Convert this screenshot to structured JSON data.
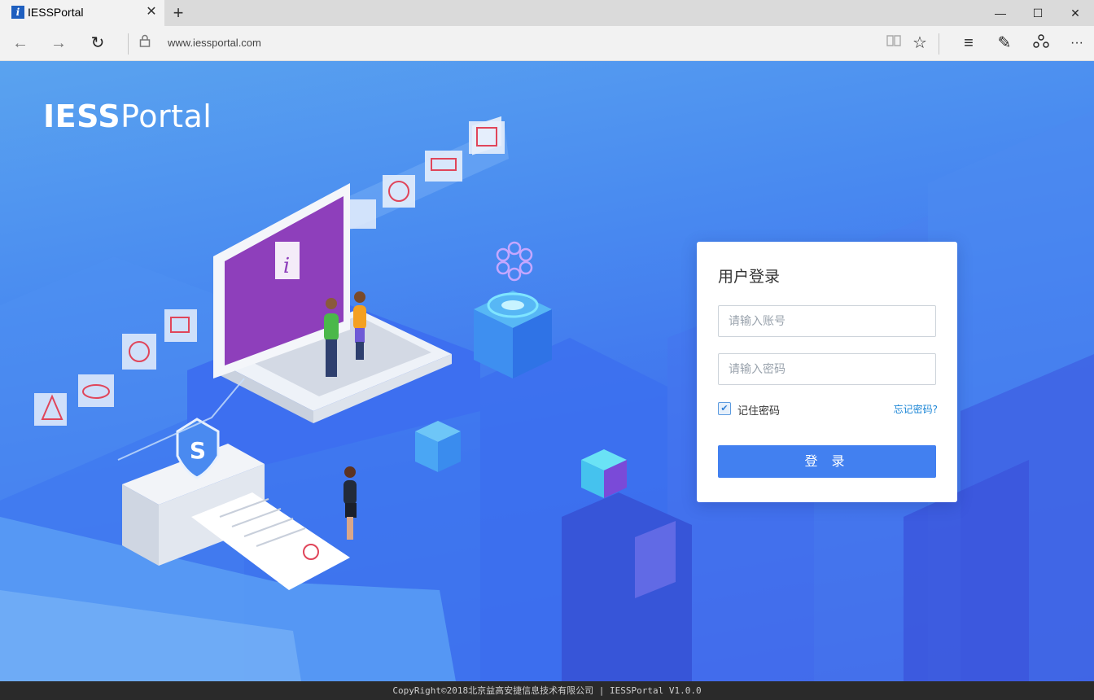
{
  "browser": {
    "tab_title": "IESSPortal",
    "tab_favicon": "i",
    "tab_close": "✕",
    "new_tab": "+",
    "url": "www.iessportal.com",
    "window_buttons": {
      "minimize": "—",
      "maximize": "☐",
      "close": "✕"
    },
    "nav_icons": {
      "back": "←",
      "forward": "→",
      "refresh": "↻",
      "lock": "🔒",
      "reading": "📖",
      "favorite": "☆",
      "hub": "≡",
      "notes": "✎",
      "share": "⇪",
      "more": "···"
    }
  },
  "page": {
    "brand_bold": "IESS",
    "brand_light": "Portal"
  },
  "login": {
    "title": "用户登录",
    "account_placeholder": "请输入账号",
    "password_placeholder": "请输入密码",
    "remember_label": "记住密码",
    "remember_checked": true,
    "check_mark": "✔",
    "forgot_label": "忘记密码?",
    "submit_label": "登 录"
  },
  "footer": {
    "text": "CopyRight©2018北京益高安捷信息技术有限公司 | IESSPortal V1.0.0"
  }
}
